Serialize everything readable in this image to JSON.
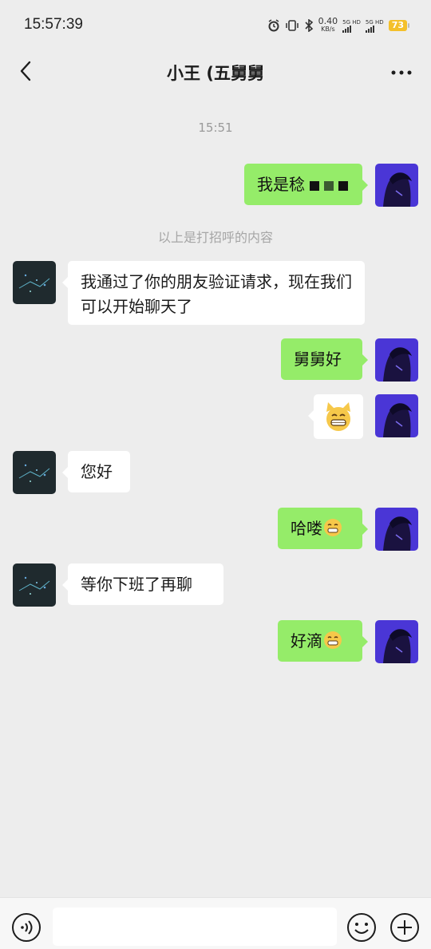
{
  "status_bar": {
    "time": "15:57:39",
    "net_speed_value": "0.40",
    "net_speed_unit": "KB/s",
    "signal1_label": "5G HD",
    "signal2_label": "5G HD",
    "battery_level": "73",
    "icons": [
      "alarm-icon",
      "vibrate-icon",
      "bluetooth-icon",
      "signal-icon",
      "battery-icon"
    ]
  },
  "header": {
    "title": "小王 (五舅舅",
    "back_icon": "chevron-left-icon",
    "more_icon": "more-dots-icon"
  },
  "chat": {
    "timestamp": "15:51",
    "greeting_notice": "以上是打招呼的内容",
    "messages": [
      {
        "side": "out",
        "text": "我是稔",
        "note": "name partially pixelated"
      },
      {
        "side": "in",
        "text": "我通过了你的朋友验证请求，现在我们可以开始聊天了"
      },
      {
        "side": "out",
        "text": "舅舅好"
      },
      {
        "side": "out",
        "text": "",
        "emoji": "cat-grin-emoji"
      },
      {
        "side": "in",
        "text": "您好"
      },
      {
        "side": "out",
        "text": "哈喽",
        "emoji": "grin-emoji"
      },
      {
        "side": "in",
        "text": "等你下班了再聊"
      },
      {
        "side": "out",
        "text": "好滴",
        "emoji": "grin-emoji"
      }
    ]
  },
  "input_bar": {
    "voice_icon": "voice-icon",
    "emoji_icon": "emoji-icon",
    "plus_icon": "plus-icon",
    "text_value": ""
  },
  "colors": {
    "background": "#ededed",
    "outgoing_bubble": "#95ec69",
    "incoming_bubble": "#ffffff",
    "battery": "#f4c02b"
  }
}
